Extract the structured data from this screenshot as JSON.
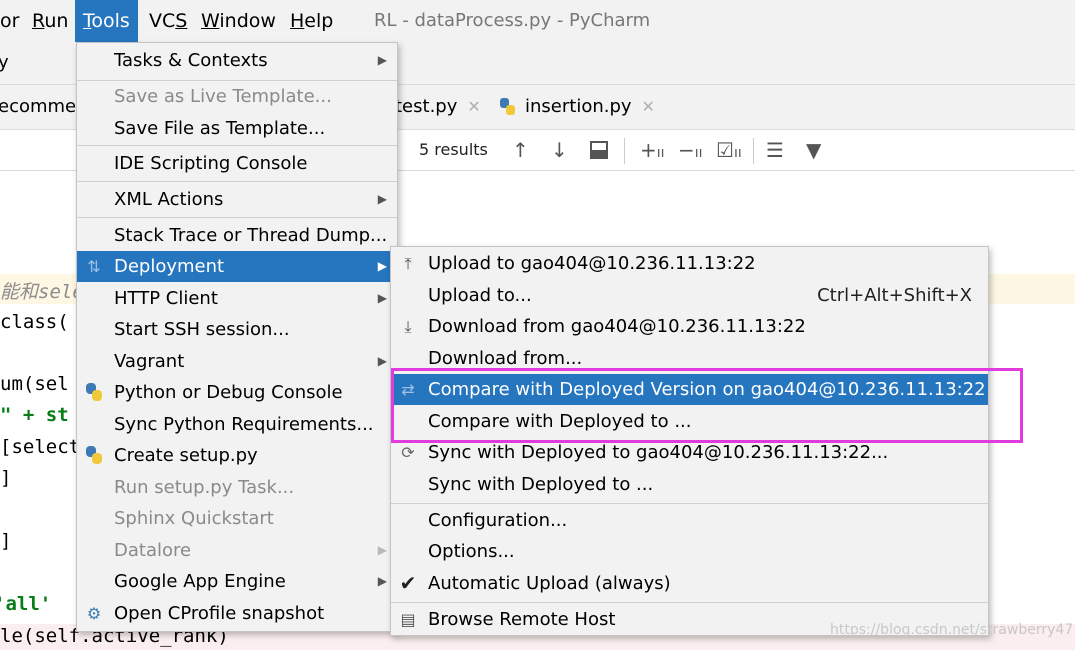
{
  "window_title": "RL - dataProcess.py - PyCharm",
  "menubar": {
    "items": [
      {
        "label": "or",
        "underline_index": -1
      },
      {
        "label": "Run",
        "underline_index": 0
      },
      {
        "label": "Tools",
        "underline_index": 0
      },
      {
        "label": "VCS",
        "underline_index": 2
      },
      {
        "label": "Window",
        "underline_index": 0
      },
      {
        "label": "Help",
        "underline_index": 0
      }
    ],
    "active": "Tools"
  },
  "nav": {
    "crumb": "y"
  },
  "tabs": [
    {
      "label": "ecomme"
    },
    {
      "label": "test.py"
    },
    {
      "label": "insertion.py"
    }
  ],
  "find": {
    "results": "5 results"
  },
  "editor": {
    "lines": [
      {
        "text": "能和sele",
        "type": "comment"
      },
      {
        "text": "class(",
        "type": "code"
      },
      {
        "text": "um(sel",
        "type": "code"
      },
      {
        "text": "\" + st",
        "type": "code"
      },
      {
        "text": "[select",
        "type": "code"
      },
      {
        "text": "]",
        "type": "code"
      },
      {
        "text": "]",
        "type": "code"
      },
      {
        "text": "'all'",
        "type": "code"
      },
      {
        "text": "le(self.active_rank)",
        "type": "code"
      }
    ]
  },
  "tools_menu": {
    "items": [
      {
        "label": "Tasks & Contexts",
        "submenu": true,
        "disabled": false
      },
      {
        "label": "Save as Live Template...",
        "submenu": false,
        "disabled": true
      },
      {
        "label": "Save File as Template...",
        "submenu": false,
        "disabled": false
      },
      {
        "label": "IDE Scripting Console",
        "submenu": false,
        "disabled": false
      },
      {
        "label": "XML Actions",
        "submenu": true,
        "disabled": false
      },
      {
        "label": "Stack Trace or Thread Dump...",
        "submenu": false,
        "disabled": false
      },
      {
        "label": "Deployment",
        "submenu": true,
        "disabled": false,
        "hover": true
      },
      {
        "label": "HTTP Client",
        "submenu": true,
        "disabled": false
      },
      {
        "label": "Start SSH session...",
        "submenu": false,
        "disabled": false
      },
      {
        "label": "Vagrant",
        "submenu": true,
        "disabled": false
      },
      {
        "label": "Python or Debug Console",
        "submenu": false,
        "disabled": false
      },
      {
        "label": "Sync Python Requirements...",
        "submenu": false,
        "disabled": false
      },
      {
        "label": "Create setup.py",
        "submenu": false,
        "disabled": false
      },
      {
        "label": "Run setup.py Task...",
        "submenu": false,
        "disabled": true
      },
      {
        "label": "Sphinx Quickstart",
        "submenu": false,
        "disabled": true
      },
      {
        "label": "Datalore",
        "submenu": true,
        "disabled": true
      },
      {
        "label": "Google App Engine",
        "submenu": true,
        "disabled": false
      },
      {
        "label": "Open CProfile snapshot",
        "submenu": false,
        "disabled": false
      }
    ]
  },
  "deployment_menu": {
    "items": [
      {
        "label": "Upload to gao404@10.236.11.13:22",
        "icon": "upload-icon",
        "shortcut": ""
      },
      {
        "label": "Upload to...",
        "icon": "",
        "shortcut": "Ctrl+Alt+Shift+X"
      },
      {
        "label": "Download from gao404@10.236.11.13:22",
        "icon": "download-icon",
        "shortcut": ""
      },
      {
        "label": "Download from...",
        "icon": "",
        "shortcut": ""
      },
      {
        "label": "Compare with Deployed Version on gao404@10.236.11.13:22",
        "icon": "compare-icon",
        "shortcut": "",
        "hover": true
      },
      {
        "label": "Compare with Deployed to ...",
        "icon": "",
        "shortcut": ""
      },
      {
        "label": "Sync with Deployed to gao404@10.236.11.13:22...",
        "icon": "sync-icon",
        "shortcut": ""
      },
      {
        "label": "Sync with Deployed to ...",
        "icon": "",
        "shortcut": ""
      },
      {
        "label": "Configuration...",
        "icon": "",
        "shortcut": ""
      },
      {
        "label": "Options...",
        "icon": "",
        "shortcut": ""
      },
      {
        "label": "Automatic Upload (always)",
        "icon": "checkmark-icon",
        "shortcut": ""
      },
      {
        "label": "Browse Remote Host",
        "icon": "remote-host-icon",
        "shortcut": ""
      }
    ]
  },
  "watermark": "https://blog.csdn.net/strawberry47",
  "colors": {
    "menu_bg": "#f2f2f2",
    "selection": "#2675bf",
    "annotation_box": "#e13be0",
    "disabled_text": "#8a8a8a"
  }
}
